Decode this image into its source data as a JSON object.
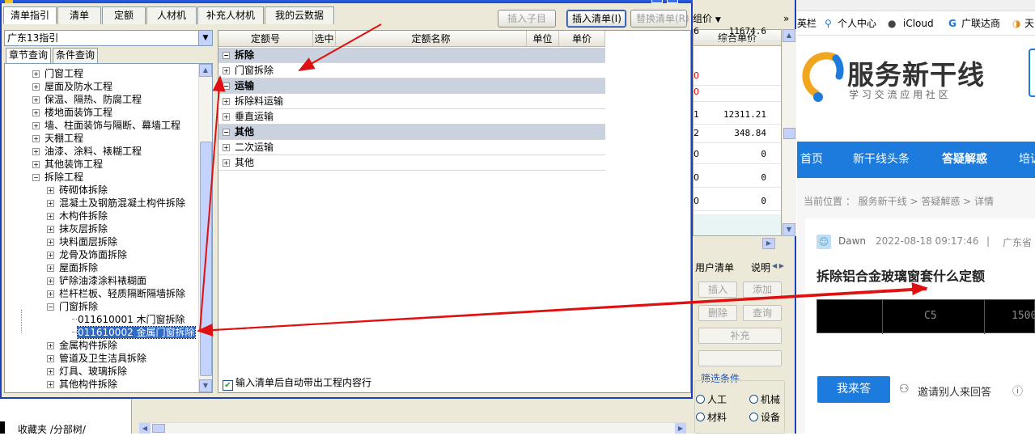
{
  "dialog": {
    "tabs": [
      "清单指引",
      "清单",
      "定额",
      "人材机",
      "补充人材机",
      "我的云数据"
    ],
    "active_tab": "清单指引",
    "buttons": {
      "insert_sub": "插入子目",
      "insert_list": "插入清单(I)",
      "replace_list": "替换清单(R)"
    },
    "region_select": "广东13指引",
    "subtabs": [
      "章节查询",
      "条件查询"
    ],
    "tree": [
      {
        "label": "门窗工程",
        "level": 1,
        "sign": "+"
      },
      {
        "label": "屋面及防水工程",
        "level": 1,
        "sign": "+"
      },
      {
        "label": "保温、隔热、防腐工程",
        "level": 1,
        "sign": "+"
      },
      {
        "label": "楼地面装饰工程",
        "level": 1,
        "sign": "+"
      },
      {
        "label": "墙、柱面装饰与隔断、幕墙工程",
        "level": 1,
        "sign": "+"
      },
      {
        "label": "天棚工程",
        "level": 1,
        "sign": "+"
      },
      {
        "label": "油漆、涂料、裱糊工程",
        "level": 1,
        "sign": "+"
      },
      {
        "label": "其他装饰工程",
        "level": 1,
        "sign": "+"
      },
      {
        "label": "拆除工程",
        "level": 1,
        "sign": "-"
      },
      {
        "label": "砖砌体拆除",
        "level": 2,
        "sign": "+"
      },
      {
        "label": "混凝土及钢筋混凝土构件拆除",
        "level": 2,
        "sign": "+"
      },
      {
        "label": "木构件拆除",
        "level": 2,
        "sign": "+"
      },
      {
        "label": "抹灰层拆除",
        "level": 2,
        "sign": "+"
      },
      {
        "label": "块料面层拆除",
        "level": 2,
        "sign": "+"
      },
      {
        "label": "龙骨及饰面拆除",
        "level": 2,
        "sign": "+"
      },
      {
        "label": "屋面拆除",
        "level": 2,
        "sign": "+"
      },
      {
        "label": "铲除油漆涂料裱糊面",
        "level": 2,
        "sign": "+"
      },
      {
        "label": "栏杆栏板、轻质隔断隔墙拆除",
        "level": 2,
        "sign": "+"
      },
      {
        "label": "门窗拆除",
        "level": 2,
        "sign": "-"
      },
      {
        "label": "011610001   木门窗拆除",
        "level": 3,
        "sign": ""
      },
      {
        "label": "011610002   金属门窗拆除",
        "level": 3,
        "sign": "",
        "selected": true
      },
      {
        "label": "金属构件拆除",
        "level": 2,
        "sign": "+"
      },
      {
        "label": "管道及卫生洁具拆除",
        "level": 2,
        "sign": "+"
      },
      {
        "label": "灯具、玻璃拆除",
        "level": 2,
        "sign": "+"
      },
      {
        "label": "其他构件拆除",
        "level": 2,
        "sign": "+"
      }
    ],
    "grid_headers": [
      "定额号",
      "选中",
      "定额名称",
      "单位",
      "单价"
    ],
    "grid_rows": [
      {
        "label": "拆除",
        "group": true
      },
      {
        "label": "门窗拆除",
        "group": false
      },
      {
        "label": "运输",
        "group": true
      },
      {
        "label": "拆除料运输",
        "group": false
      },
      {
        "label": "垂直运输",
        "group": false
      },
      {
        "label": "其他",
        "group": true
      },
      {
        "label": "二次运输",
        "group": false
      },
      {
        "label": "其他",
        "group": false
      }
    ],
    "auto_checkbox": "输入清单后自动带出工程内容行"
  },
  "bottom": {
    "tabs_text": "收藏夹 /分部树/"
  },
  "mid_app": {
    "header_partial": "组价",
    "col_header": "综合单价",
    "row_prefixes": [
      "6",
      "0",
      "0",
      "1",
      "2",
      "0",
      "0",
      "0"
    ],
    "values": [
      "11674.6",
      "",
      "",
      "12311.21",
      "348.84",
      "0",
      "0",
      "0"
    ],
    "tabs": [
      "用户清单",
      "说明"
    ],
    "buttons": {
      "insert": "插入",
      "add": "添加",
      "delete": "删除",
      "query": "查询",
      "supplement": "补充"
    },
    "filter_title": "筛选条件",
    "radios": [
      "人工",
      "机械",
      "材料",
      "设备"
    ]
  },
  "browser": {
    "bookmarks": [
      "英栏",
      "个人中心",
      "iCloud",
      "广联达商",
      "天"
    ],
    "site_name": "服务新干线",
    "site_slogan": "学 习 交 流 应 用 社 区",
    "nav": [
      "首页",
      "新干线头条",
      "答疑解惑",
      "培训"
    ],
    "breadcrumb": "当前位置 ： 服务新干线 > 答疑解惑 > 详情",
    "author": "Dawn",
    "date": "2022-08-18 09:17:46",
    "separator": "|",
    "location": "广东省",
    "question_title": "拆除铝合金玻璃窗套什么定额",
    "image_cells": [
      "C5",
      "1500"
    ],
    "answer_button": "我来答",
    "invite_text": "邀请别人来回答"
  },
  "colors": {
    "accent": "#1c7bdc",
    "arrow": "#e01010",
    "window_border": "#1a3fb8",
    "selection": "#316ac5"
  }
}
